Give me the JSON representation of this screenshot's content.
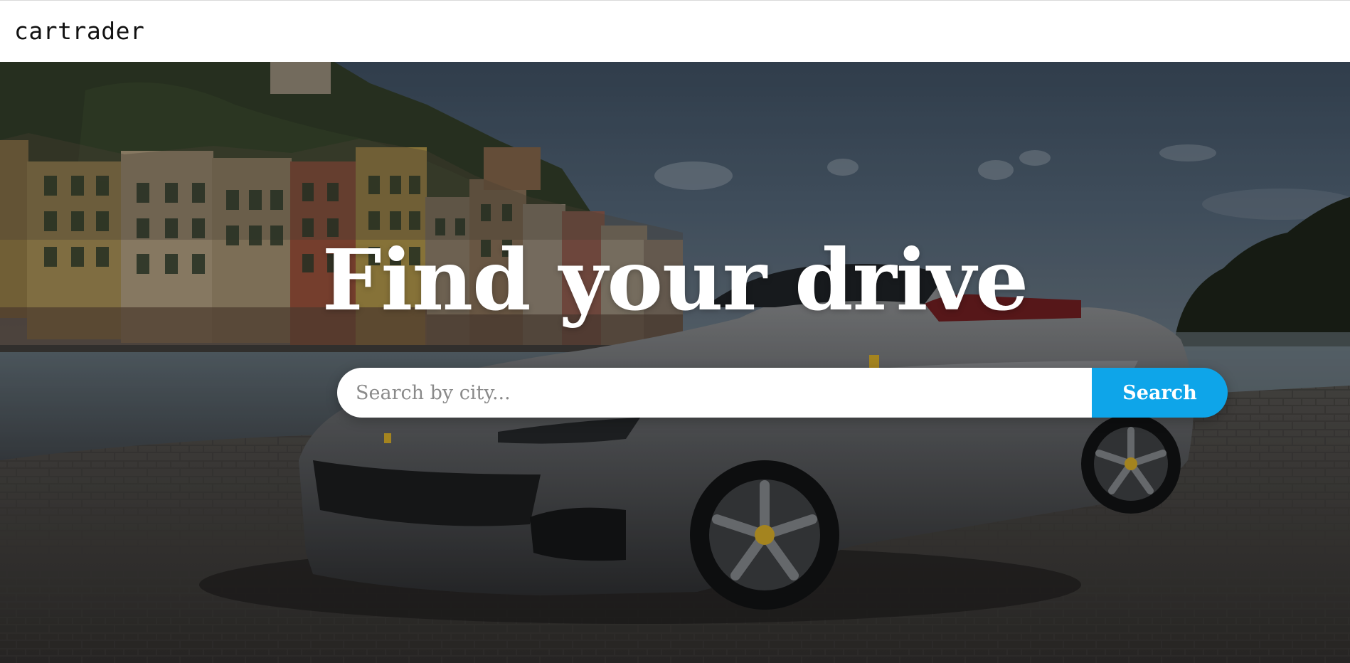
{
  "navbar": {
    "logo_text": "cartrader"
  },
  "hero": {
    "background_image": "harbor-town-convertible-sports-car-photo",
    "headline": "Find your drive",
    "search": {
      "placeholder": "Search by city...",
      "value": "",
      "button_label": "Search"
    }
  },
  "colors": {
    "accent": "#0ea5e9",
    "navbar_bg": "#ffffff",
    "headline": "#ffffff"
  }
}
